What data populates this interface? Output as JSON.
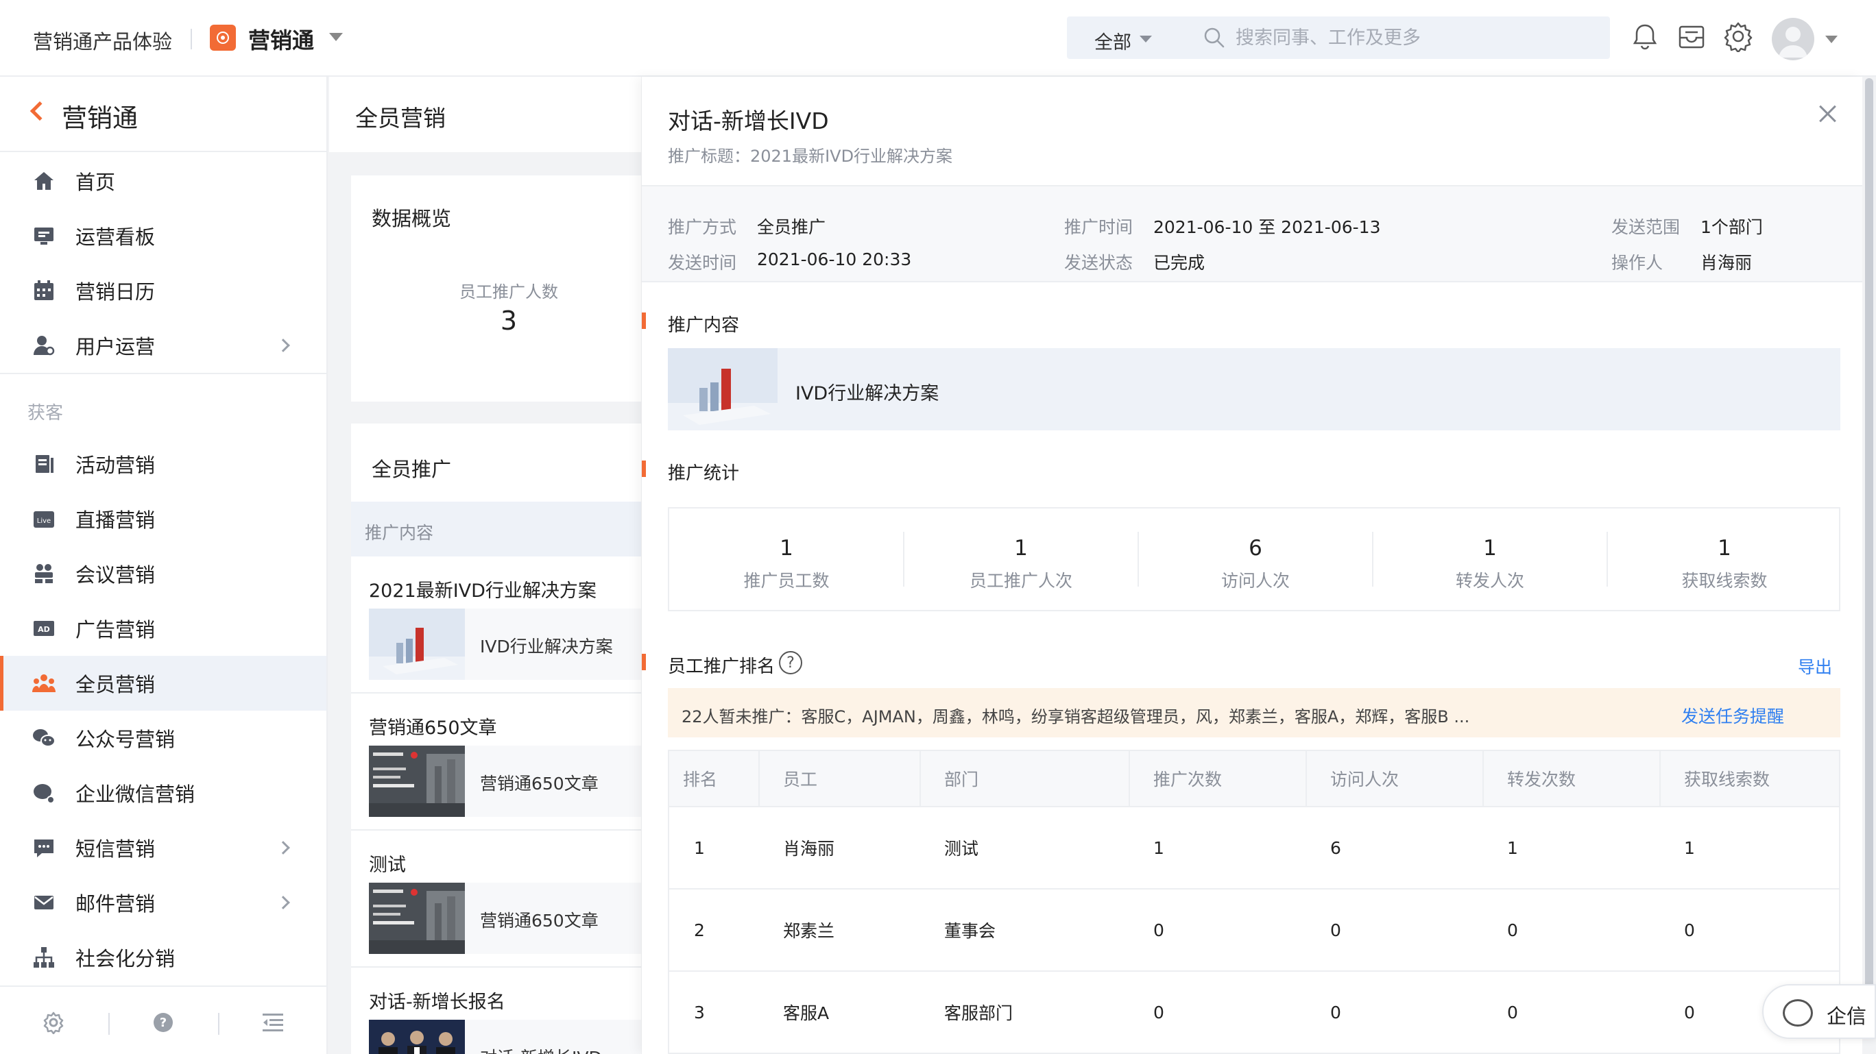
{
  "topbar": {
    "product_name": "营销通产品体验",
    "app_name": "营销通",
    "search_scope": "全部",
    "search_placeholder": "搜索同事、工作及更多"
  },
  "icons": {
    "bell": "bell-icon",
    "inbox": "inbox-icon",
    "settings": "gear-icon",
    "avatar": "user-avatar"
  },
  "sidebar": {
    "title": "营销通",
    "items_top": [
      {
        "label": "首页",
        "icon": "home-icon"
      },
      {
        "label": "运营看板",
        "icon": "dashboard-icon"
      },
      {
        "label": "营销日历",
        "icon": "calendar-icon"
      },
      {
        "label": "用户运营",
        "icon": "user-operation-icon",
        "has_children": true
      }
    ],
    "group_label": "获客",
    "items_acquire": [
      {
        "label": "活动营销",
        "icon": "activity-icon"
      },
      {
        "label": "直播营销",
        "icon": "live-icon"
      },
      {
        "label": "会议营销",
        "icon": "meeting-icon"
      },
      {
        "label": "广告营销",
        "icon": "ad-icon"
      },
      {
        "label": "全员营销",
        "icon": "team-marketing-icon",
        "active": true
      },
      {
        "label": "公众号营销",
        "icon": "wechat-icon"
      },
      {
        "label": "企业微信营销",
        "icon": "work-wechat-icon"
      },
      {
        "label": "短信营销",
        "icon": "sms-icon",
        "has_children": true
      },
      {
        "label": "邮件营销",
        "icon": "mail-icon",
        "has_children": true
      },
      {
        "label": "社会化分销",
        "icon": "org-tree-icon"
      }
    ]
  },
  "middle": {
    "title": "全员营销",
    "overview": {
      "title": "数据概览",
      "metric_label": "员工推广人数",
      "metric_value": "3"
    },
    "promotions": {
      "title": "全员推广",
      "column_header": "推广内容",
      "items": [
        {
          "title": "2021最新IVD行业解决方案",
          "content_name": "IVD行业解决方案"
        },
        {
          "title": "营销通650文章",
          "content_name": "营销通650文章"
        },
        {
          "title": "测试",
          "content_name": "营销通650文章"
        },
        {
          "title": "对话-新增长报名",
          "content_name": "对话-新增长IVD"
        }
      ]
    }
  },
  "detail": {
    "title": "对话-新增长IVD",
    "subtitle": "推广标题：2021最新IVD行业解决方案",
    "meta": {
      "method_label": "推广方式",
      "method_value": "全员推广",
      "period_label": "推广时间",
      "period_value": "2021-06-10 至 2021-06-13",
      "scope_label": "发送范围",
      "scope_value": "1个部门",
      "sent_label": "发送时间",
      "sent_value": "2021-06-10 20:33",
      "status_label": "发送状态",
      "status_value": "已完成",
      "operator_label": "操作人",
      "operator_value": "肖海丽"
    },
    "content_section": "推广内容",
    "content_name": "IVD行业解决方案",
    "stats_section": "推广统计",
    "stats": [
      {
        "value": "1",
        "label": "推广员工数"
      },
      {
        "value": "1",
        "label": "员工推广人次"
      },
      {
        "value": "6",
        "label": "访问人次"
      },
      {
        "value": "1",
        "label": "转发人次"
      },
      {
        "value": "1",
        "label": "获取线索数"
      }
    ],
    "ranking_section": "员工推广排名",
    "export_label": "导出",
    "notice_text": "22人暂未推广：客服C，AJMAN，周鑫，林鸣，纷享销客超级管理员，风，郑素兰，客服A，郑辉，客服B ...",
    "notice_action": "发送任务提醒",
    "ranking_headers": [
      "排名",
      "员工",
      "部门",
      "推广次数",
      "访问人次",
      "转发次数",
      "获取线索数"
    ],
    "ranking_rows": [
      [
        "1",
        "肖海丽",
        "测试",
        "1",
        "6",
        "1",
        "1"
      ],
      [
        "2",
        "郑素兰",
        "董事会",
        "0",
        "0",
        "0",
        "0"
      ],
      [
        "3",
        "客服A",
        "客服部门",
        "0",
        "0",
        "0",
        "0"
      ]
    ]
  },
  "chat_float_label": "企信",
  "colors": {
    "accent": "#f26b35",
    "link": "#2f7ff0",
    "active_bg": "#eef2f8",
    "notice_bg": "#fdf3e7"
  }
}
